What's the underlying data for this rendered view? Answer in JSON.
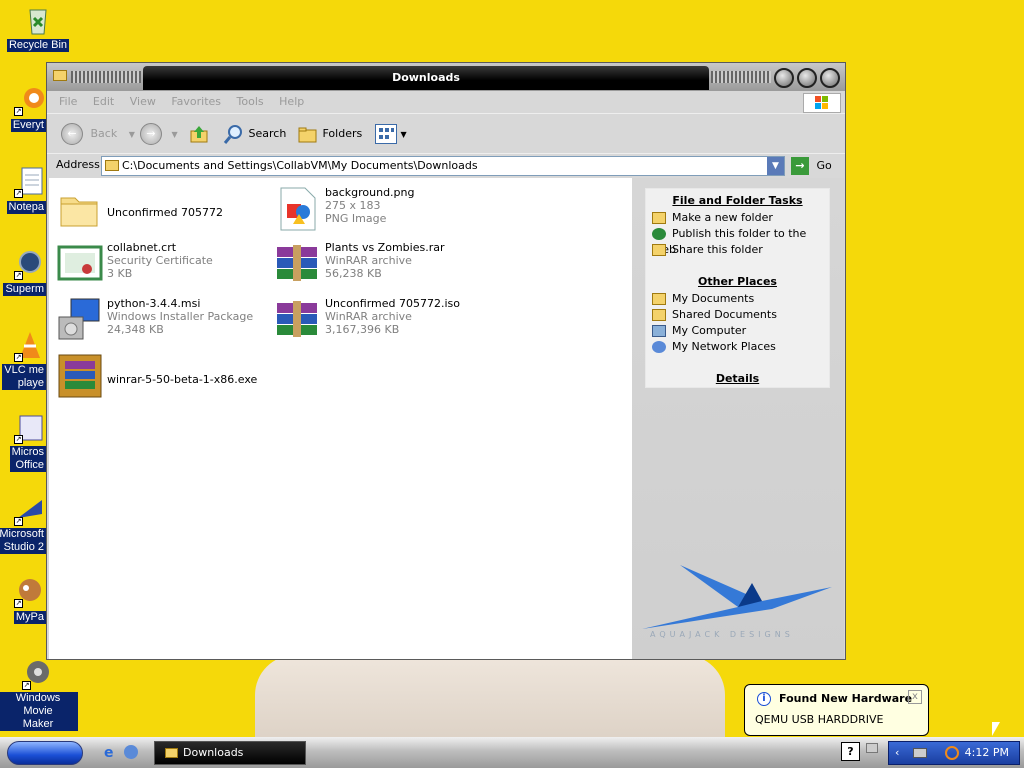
{
  "desktop": {
    "icons": [
      {
        "label": "Recycle Bin"
      },
      {
        "label": "Everyt"
      },
      {
        "label": "Notepa"
      },
      {
        "label": "Superm"
      },
      {
        "label": "VLC me\nplaye"
      },
      {
        "label": "Micros\nOffice"
      },
      {
        "label": "Microsoft\nStudio 2"
      },
      {
        "label": "MyPa"
      },
      {
        "label": "Windows Movie\nMaker"
      }
    ]
  },
  "window": {
    "title": "Downloads",
    "menu": [
      "File",
      "Edit",
      "View",
      "Favorites",
      "Tools",
      "Help"
    ],
    "toolbar": {
      "back": "Back",
      "search": "Search",
      "folders": "Folders"
    },
    "address": {
      "label": "Address",
      "value": "C:\\Documents and Settings\\CollabVM\\My Documents\\Downloads",
      "go": "Go"
    },
    "files": [
      {
        "name": "Unconfirmed 705772",
        "line2": "",
        "line3": "",
        "icon": "folder-icon"
      },
      {
        "name": "background.png",
        "line2": "275 x 183",
        "line3": "PNG Image",
        "icon": "png-image-icon"
      },
      {
        "name": "collabnet.crt",
        "line2": "Security Certificate",
        "line3": "3 KB",
        "icon": "certificate-icon"
      },
      {
        "name": "Plants vs Zombies.rar",
        "line2": "WinRAR archive",
        "line3": "56,238 KB",
        "icon": "winrar-archive-icon"
      },
      {
        "name": "python-3.4.4.msi",
        "line2": "Windows Installer Package",
        "line3": "24,348 KB",
        "icon": "installer-package-icon"
      },
      {
        "name": "Unconfirmed 705772.iso",
        "line2": "WinRAR archive",
        "line3": "3,167,396 KB",
        "icon": "winrar-archive-icon"
      },
      {
        "name": "winrar-5-50-beta-1-x86.exe",
        "line2": "",
        "line3": "",
        "icon": "winrar-installer-icon"
      }
    ],
    "taskpane": {
      "file_folder_tasks": {
        "title": "File and Folder Tasks",
        "items": [
          "Make a new folder",
          "Publish this folder to the Web",
          "Share this folder"
        ]
      },
      "other_places": {
        "title": "Other Places",
        "items": [
          "My Documents",
          "Shared Documents",
          "My Computer",
          "My Network Places"
        ]
      },
      "details": {
        "title": "Details"
      },
      "brand_text": "AQUAJACK DESIGNS"
    }
  },
  "balloon": {
    "title": "Found New Hardware",
    "text": "QEMU USB HARDDRIVE",
    "close": "x"
  },
  "taskbar": {
    "task": "Downloads",
    "help": "?",
    "clock": "4:12 PM"
  },
  "colors": {
    "desktop": "#f5d90a",
    "title_bar": "#000000",
    "tray": "#1a3ea0"
  }
}
